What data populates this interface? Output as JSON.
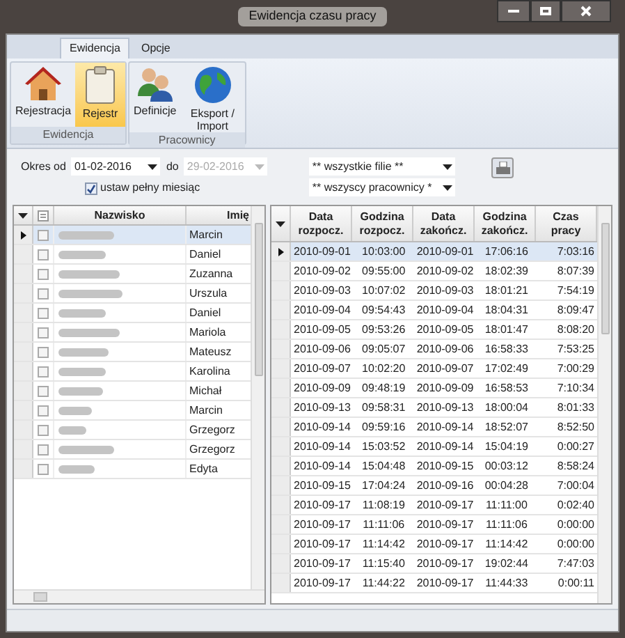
{
  "window": {
    "title": "Ewidencja czasu pracy"
  },
  "ribbon_tabs": [
    {
      "label": "Ewidencja",
      "selected": true
    },
    {
      "label": "Opcje",
      "selected": false
    }
  ],
  "ribbon_groups": [
    {
      "label": "Ewidencja",
      "buttons": [
        {
          "label": "Rejestracja",
          "kind": "house",
          "selected": false
        },
        {
          "label": "Rejestr",
          "kind": "clipboard",
          "selected": true
        }
      ]
    },
    {
      "label": "Pracownicy",
      "buttons": [
        {
          "label": "Definicje",
          "kind": "people",
          "selected": false
        },
        {
          "label": "Eksport / Import",
          "kind": "globe",
          "selected": false
        }
      ]
    }
  ],
  "filters": {
    "from_label": "Okres od",
    "from_value": "01-02-2016",
    "to_label": "do",
    "to_value": "29-02-2016",
    "to_disabled": true,
    "full_month": {
      "label": "ustaw pełny miesiąc",
      "checked": true
    },
    "branch": "** wszystkie filie **",
    "employees": "** wszyscy pracownicy *"
  },
  "employees": {
    "columns": [
      "Nazwisko",
      "Imię"
    ],
    "rows": [
      {
        "first_name": "Marcin",
        "checked": false,
        "selected": true
      },
      {
        "first_name": "Daniel",
        "checked": false,
        "selected": false
      },
      {
        "first_name": "Zuzanna",
        "checked": false,
        "selected": false
      },
      {
        "first_name": "Urszula",
        "checked": false,
        "selected": false
      },
      {
        "first_name": "Daniel",
        "checked": false,
        "selected": false
      },
      {
        "first_name": "Mariola",
        "checked": false,
        "selected": false
      },
      {
        "first_name": "Mateusz",
        "checked": false,
        "selected": false
      },
      {
        "first_name": "Karolina",
        "checked": false,
        "selected": false
      },
      {
        "first_name": "Michał",
        "checked": false,
        "selected": false
      },
      {
        "first_name": "Marcin",
        "checked": false,
        "selected": false
      },
      {
        "first_name": "Grzegorz",
        "checked": false,
        "selected": false
      },
      {
        "first_name": "Grzegorz",
        "checked": false,
        "selected": false
      },
      {
        "first_name": "Edyta",
        "checked": false,
        "selected": false
      }
    ]
  },
  "records": {
    "columns": [
      "Data rozpocz.",
      "Godzina rozpocz.",
      "Data zakończ.",
      "Godzina zakończ.",
      "Czas pracy"
    ],
    "rows": [
      {
        "cells": [
          "2010-09-01",
          "10:03:00",
          "2010-09-01",
          "17:06:16",
          "7:03:16"
        ],
        "selected": true
      },
      {
        "cells": [
          "2010-09-02",
          "09:55:00",
          "2010-09-02",
          "18:02:39",
          "8:07:39"
        ],
        "selected": false
      },
      {
        "cells": [
          "2010-09-03",
          "10:07:02",
          "2010-09-03",
          "18:01:21",
          "7:54:19"
        ],
        "selected": false
      },
      {
        "cells": [
          "2010-09-04",
          "09:54:43",
          "2010-09-04",
          "18:04:31",
          "8:09:47"
        ],
        "selected": false
      },
      {
        "cells": [
          "2010-09-05",
          "09:53:26",
          "2010-09-05",
          "18:01:47",
          "8:08:20"
        ],
        "selected": false
      },
      {
        "cells": [
          "2010-09-06",
          "09:05:07",
          "2010-09-06",
          "16:58:33",
          "7:53:25"
        ],
        "selected": false
      },
      {
        "cells": [
          "2010-09-07",
          "10:02:20",
          "2010-09-07",
          "17:02:49",
          "7:00:29"
        ],
        "selected": false
      },
      {
        "cells": [
          "2010-09-09",
          "09:48:19",
          "2010-09-09",
          "16:58:53",
          "7:10:34"
        ],
        "selected": false
      },
      {
        "cells": [
          "2010-09-13",
          "09:58:31",
          "2010-09-13",
          "18:00:04",
          "8:01:33"
        ],
        "selected": false
      },
      {
        "cells": [
          "2010-09-14",
          "09:59:16",
          "2010-09-14",
          "18:52:07",
          "8:52:50"
        ],
        "selected": false
      },
      {
        "cells": [
          "2010-09-14",
          "15:03:52",
          "2010-09-14",
          "15:04:19",
          "0:00:27"
        ],
        "selected": false
      },
      {
        "cells": [
          "2010-09-14",
          "15:04:48",
          "2010-09-15",
          "00:03:12",
          "8:58:24"
        ],
        "selected": false
      },
      {
        "cells": [
          "2010-09-15",
          "17:04:24",
          "2010-09-16",
          "00:04:28",
          "7:00:04"
        ],
        "selected": false
      },
      {
        "cells": [
          "2010-09-17",
          "11:08:19",
          "2010-09-17",
          "11:11:00",
          "0:02:40"
        ],
        "selected": false
      },
      {
        "cells": [
          "2010-09-17",
          "11:11:06",
          "2010-09-17",
          "11:11:06",
          "0:00:00"
        ],
        "selected": false
      },
      {
        "cells": [
          "2010-09-17",
          "11:14:42",
          "2010-09-17",
          "11:14:42",
          "0:00:00"
        ],
        "selected": false
      },
      {
        "cells": [
          "2010-09-17",
          "11:15:40",
          "2010-09-17",
          "19:02:44",
          "7:47:03"
        ],
        "selected": false
      },
      {
        "cells": [
          "2010-09-17",
          "11:44:22",
          "2010-09-17",
          "11:44:33",
          "0:00:11"
        ],
        "selected": false
      }
    ]
  }
}
